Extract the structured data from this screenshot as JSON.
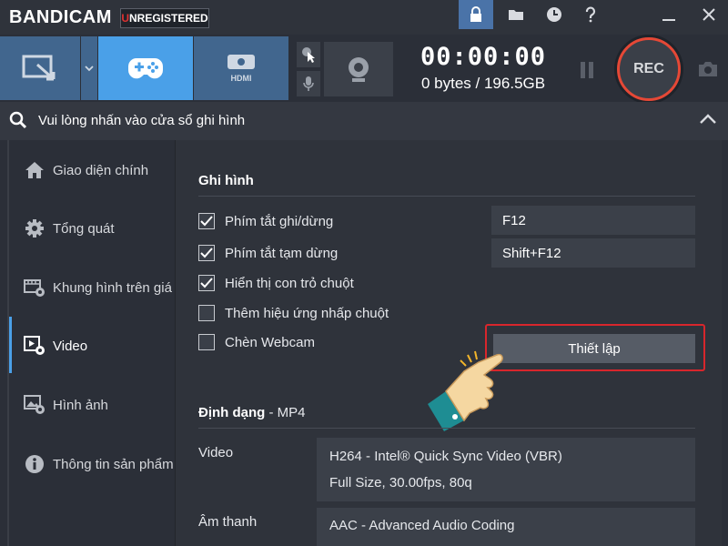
{
  "app": {
    "brand": "BANDICAM",
    "unregistered_first": "U",
    "unregistered_rest": "NREGISTERED"
  },
  "toolbar": {
    "timer": "00:00:00",
    "filesize": "0 bytes / 196.5GB",
    "rec_label": "REC",
    "hdmi_label": "HDMI"
  },
  "status": {
    "text": "Vui lòng nhấn vào cửa sổ ghi hình"
  },
  "sidebar": {
    "items": [
      {
        "label": "Giao diện chính",
        "icon": "home-icon"
      },
      {
        "label": "Tổng quát",
        "icon": "gear-icon"
      },
      {
        "label": "Khung hình trên giá",
        "icon": "fps-icon"
      },
      {
        "label": "Video",
        "icon": "video-settings-icon",
        "active": true
      },
      {
        "label": "Hình ảnh",
        "icon": "image-settings-icon"
      },
      {
        "label": "Thông tin sản phẩm",
        "icon": "info-icon"
      }
    ]
  },
  "record": {
    "section_title": "Ghi hình",
    "options": [
      {
        "label": "Phím tắt ghi/dừng",
        "checked": true
      },
      {
        "label": "Phím tắt tạm dừng",
        "checked": true
      },
      {
        "label": "Hiển thị con trỏ chuột",
        "checked": true
      },
      {
        "label": "Thêm hiệu ứng nhấp chuột",
        "checked": false
      },
      {
        "label": "Chèn Webcam",
        "checked": false
      }
    ],
    "hotkeys": [
      "F12",
      "Shift+F12"
    ],
    "settings_button": "Thiết lập"
  },
  "format": {
    "title_bold": "Định dạng",
    "title_rest": " - MP4",
    "video_label": "Video",
    "video_line1": "H264 - Intel® Quick Sync Video (VBR)",
    "video_line2": "Full Size, 30.00fps, 80q",
    "audio_label": "Âm thanh",
    "audio_line1": "AAC - Advanced Audio Coding"
  },
  "colors": {
    "accent": "#4aa0e8",
    "rec_ring": "#e54836",
    "highlight": "#d8262c"
  }
}
